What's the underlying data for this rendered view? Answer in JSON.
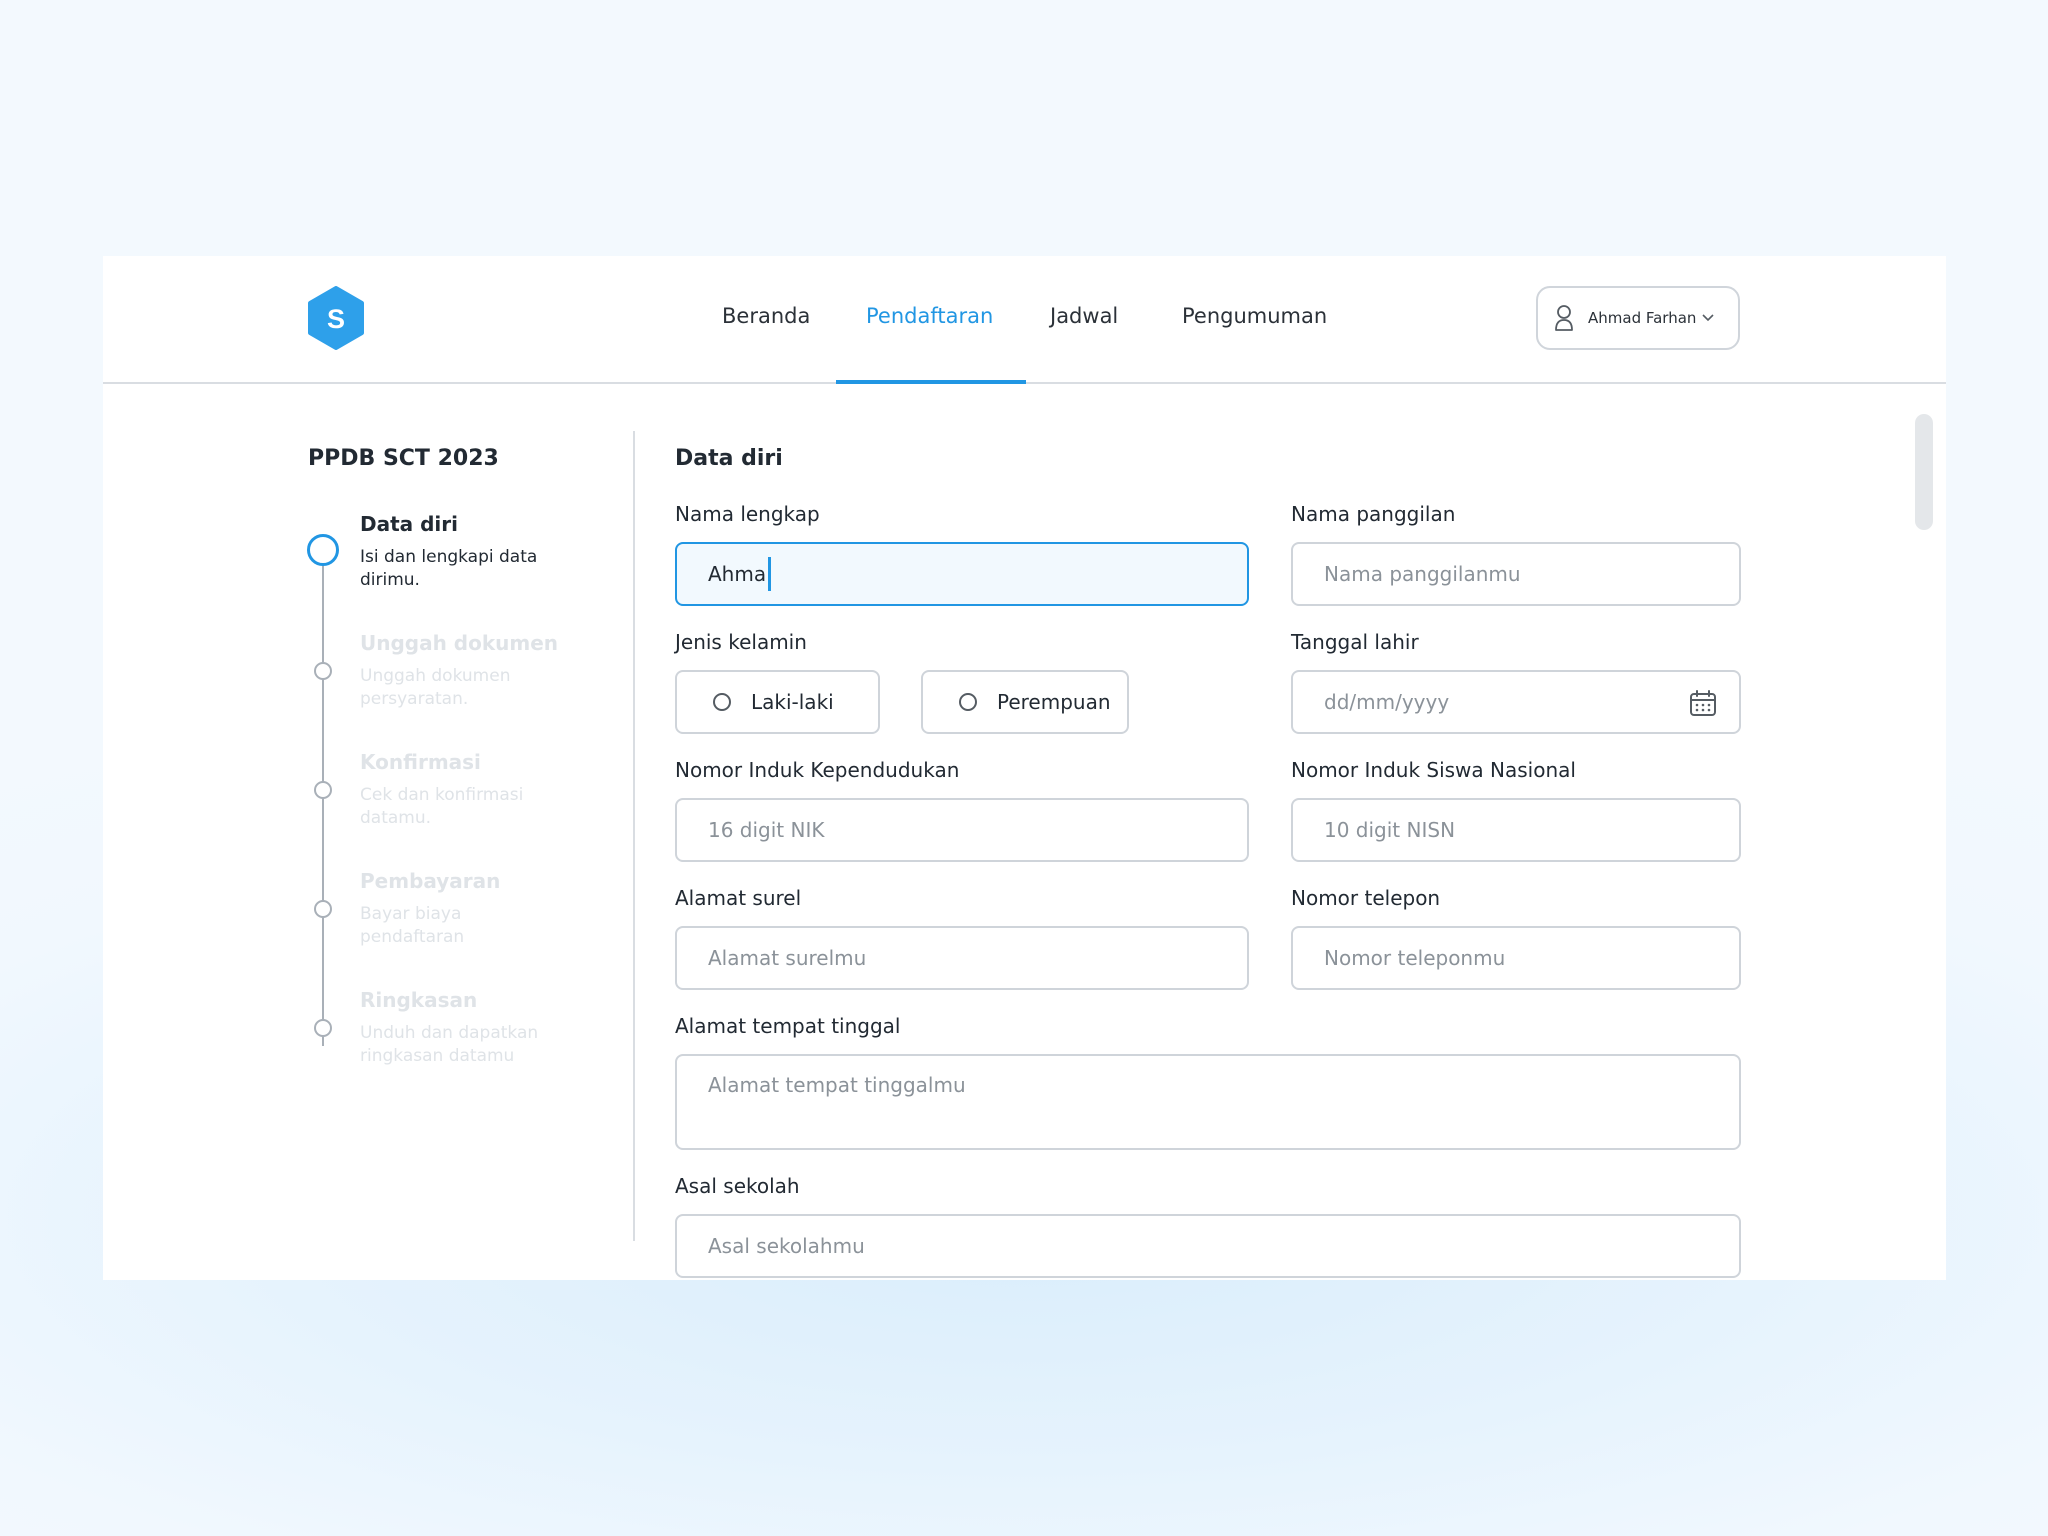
{
  "header": {
    "logo_letter": "S",
    "nav": [
      {
        "label": "Beranda"
      },
      {
        "label": "Pendaftaran"
      },
      {
        "label": "Jadwal"
      },
      {
        "label": "Pengumuman"
      }
    ],
    "active_nav": "Pendaftaran",
    "user": {
      "name": "Ahmad Farhan"
    }
  },
  "sidebar": {
    "title": "PPDB SCT 2023",
    "steps": [
      {
        "title": "Data diri",
        "desc": "Isi dan lengkapi data dirimu.",
        "state": "active"
      },
      {
        "title": "Unggah dokumen",
        "desc": "Unggah dokumen persyaratan.",
        "state": "pending"
      },
      {
        "title": "Konfirmasi",
        "desc": "Cek dan konfirmasi datamu.",
        "state": "pending"
      },
      {
        "title": "Pembayaran",
        "desc": "Bayar biaya pendaftaran",
        "state": "pending"
      },
      {
        "title": "Ringkasan",
        "desc": "Unduh dan dapatkan ringkasan datamu",
        "state": "pending"
      }
    ]
  },
  "form": {
    "title": "Data diri",
    "nama_lengkap": {
      "label": "Nama lengkap",
      "value": "Ahma"
    },
    "nama_panggilan": {
      "label": "Nama panggilan",
      "placeholder": "Nama panggilanmu"
    },
    "jenis_kelamin": {
      "label": "Jenis kelamin",
      "options": [
        "Laki-laki",
        "Perempuan"
      ]
    },
    "tanggal_lahir": {
      "label": "Tanggal lahir",
      "placeholder": "dd/mm/yyyy"
    },
    "nik": {
      "label": "Nomor Induk Kependudukan",
      "placeholder": "16 digit NIK"
    },
    "nisn": {
      "label": "Nomor Induk Siswa Nasional",
      "placeholder": "10 digit NISN"
    },
    "email": {
      "label": "Alamat surel",
      "placeholder": "Alamat surelmu"
    },
    "telepon": {
      "label": "Nomor telepon",
      "placeholder": "Nomor teleponmu"
    },
    "alamat": {
      "label": "Alamat tempat tinggal",
      "placeholder": "Alamat tempat tinggalmu"
    },
    "sekolah": {
      "label": "Asal sekolah",
      "placeholder": "Asal sekolahmu"
    }
  },
  "colors": {
    "accent": "#2196e3",
    "muted_text": "#dfe3e7",
    "border": "#cfd4da"
  }
}
